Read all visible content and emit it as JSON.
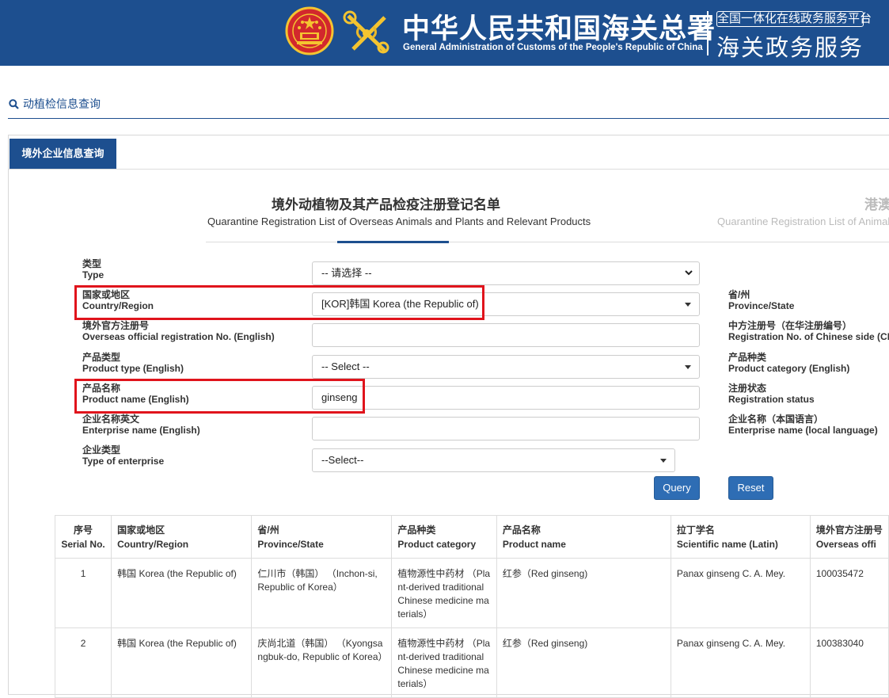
{
  "header": {
    "title_cn": "中华人民共和国海关总署",
    "title_en": "General Administration of Customs of the People's Republic of China",
    "platform_label": "全国一体化在线政务服务平台",
    "service_label": "海关政务服务",
    "colors": {
      "background": "#1d4f8f",
      "text": "#ffffff",
      "emblem_red": "#d2282d",
      "emblem_gold": "#f4c430"
    }
  },
  "breadcrumb": {
    "icon": "search-icon",
    "label": "动植检信息查询"
  },
  "tabs": [
    {
      "label": "境外企业信息查询",
      "active": true
    }
  ],
  "list_titles": [
    {
      "cn": "境外动植物及其产品检疫注册登记名单",
      "en": "Quarantine Registration List of Overseas Animals and Plants and Relevant Products",
      "active": true
    },
    {
      "cn": "港澳",
      "en": "Quarantine Registration List of Animals",
      "active": false
    }
  ],
  "form": {
    "type": {
      "label_cn": "类型",
      "label_en": "Type",
      "value": "-- 请选择 --"
    },
    "country": {
      "label_cn": "国家或地区",
      "label_en": "Country/Region",
      "value": "[KOR]韩国 Korea (the Republic of)",
      "highlighted": true
    },
    "province": {
      "label_cn": "省/州",
      "label_en": "Province/State"
    },
    "overseas_reg_no": {
      "label_cn": "境外官方注册号",
      "label_en": "Overseas official registration No. (English)",
      "value": ""
    },
    "chinese_reg_no": {
      "label_cn": "中方注册号（在华注册编号）",
      "label_en": "Registration No. of Chinese side (CH"
    },
    "product_type": {
      "label_cn": "产品类型",
      "label_en": "Product type (English)",
      "value": "-- Select --"
    },
    "product_category": {
      "label_cn": "产品种类",
      "label_en": "Product category (English)"
    },
    "product_name": {
      "label_cn": "产品名称",
      "label_en": "Product name (English)",
      "value": "ginseng",
      "highlighted": true
    },
    "registration_status": {
      "label_cn": "注册状态",
      "label_en": "Registration status"
    },
    "enterprise_name_en": {
      "label_cn": "企业名称英文",
      "label_en": "Enterprise name (English)",
      "value": ""
    },
    "enterprise_name_local": {
      "label_cn": "企业名称（本国语言）",
      "label_en": "Enterprise name (local language)"
    },
    "enterprise_type": {
      "label_cn": "企业类型",
      "label_en": "Type of enterprise",
      "value": "--Select--"
    },
    "query_label": "Query",
    "reset_label": "Reset",
    "highlight_color": "#e0141c"
  },
  "table": {
    "headers": [
      {
        "cn": "序号",
        "en": "Serial No."
      },
      {
        "cn": "国家或地区",
        "en": "Country/Region"
      },
      {
        "cn": "省/州",
        "en": "Province/State"
      },
      {
        "cn": "产品种类",
        "en": "Product category"
      },
      {
        "cn": "产品名称",
        "en": "Product name"
      },
      {
        "cn": "拉丁学名",
        "en": "Scientific name (Latin)"
      },
      {
        "cn": "境外官方注册号",
        "en": "Overseas offi"
      }
    ],
    "rows": [
      {
        "serial": "1",
        "country": "韩国 Korea (the Republic of)",
        "province": "仁川市（韩国） （Inchon-si, Republic of Korea）",
        "category": "植物源性中药材 （Plant-derived traditional Chinese medicine materials）",
        "product": "红参（Red ginseng)",
        "latin": "Panax ginseng C. A. Mey.",
        "reg_no": "100035472"
      },
      {
        "serial": "2",
        "country": "韩国 Korea (the Republic of)",
        "province": "庆尚北道（韩国） （Kyongsangbuk-do, Republic of Korea）",
        "category": "植物源性中药材 （Plant-derived traditional Chinese medicine materials）",
        "product": "红参（Red ginseng)",
        "latin": "Panax ginseng C. A. Mey.",
        "reg_no": "100383040"
      }
    ]
  }
}
